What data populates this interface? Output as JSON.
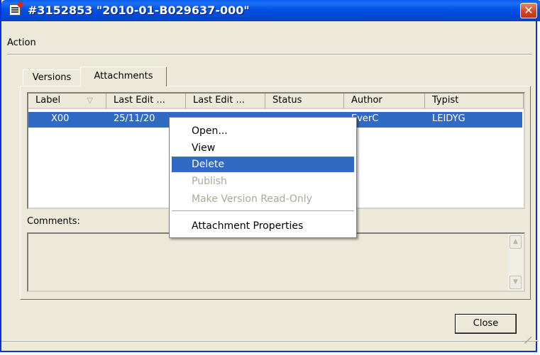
{
  "window": {
    "title": "#3152853 \"2010-01-B029637-000\"",
    "close_glyph": "✕",
    "accent": "#0054e3"
  },
  "menu": {
    "action_label": "Action"
  },
  "tabs": [
    {
      "label": "Versions",
      "active": false
    },
    {
      "label": "Attachments",
      "active": true
    }
  ],
  "list": {
    "columns": [
      "Label",
      "Last Edit ...",
      "Last Edit ...",
      "Status",
      "Author",
      "Typist"
    ],
    "sort_indicator": "▽",
    "rows": [
      {
        "label": "X00",
        "last_edit_1": "25/11/20",
        "last_edit_2": "",
        "status": "",
        "author": "EverC",
        "typist": "LEIDYG"
      }
    ],
    "selection_color": "#316ac5"
  },
  "comments": {
    "label": "Comments:"
  },
  "buttons": {
    "close_label": "Close"
  },
  "context_menu": {
    "items": [
      {
        "label": "Open...",
        "enabled": true,
        "highlighted": false
      },
      {
        "label": "View",
        "enabled": true,
        "highlighted": false
      },
      {
        "label": "Delete",
        "enabled": true,
        "highlighted": true
      },
      {
        "label": "Publish",
        "enabled": false,
        "highlighted": false
      },
      {
        "label": "Make Version Read-Only",
        "enabled": false,
        "highlighted": false
      },
      {
        "label": "Attachment Properties",
        "enabled": true,
        "highlighted": false
      }
    ]
  }
}
